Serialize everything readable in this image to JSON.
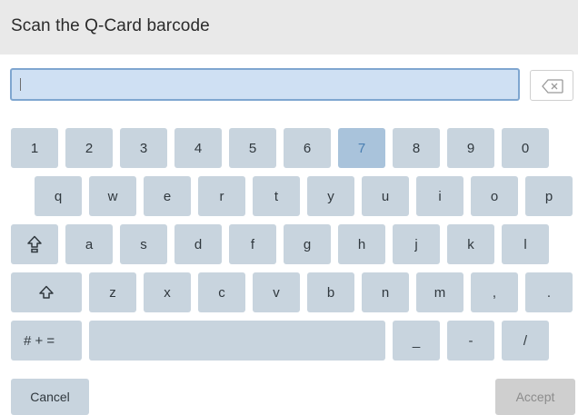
{
  "header": {
    "title": "Scan the Q-Card barcode"
  },
  "input": {
    "value": ""
  },
  "keyboard": {
    "row1": [
      "1",
      "2",
      "3",
      "4",
      "5",
      "6",
      "7",
      "8",
      "9",
      "0"
    ],
    "row2": [
      "q",
      "w",
      "e",
      "r",
      "t",
      "y",
      "u",
      "i",
      "o",
      "p"
    ],
    "row3": [
      "a",
      "s",
      "d",
      "f",
      "g",
      "h",
      "j",
      "k",
      "l"
    ],
    "row4": [
      "z",
      "x",
      "c",
      "v",
      "b",
      "n",
      "m",
      ",",
      "."
    ],
    "row5": {
      "symbols_label": "# + =",
      "underscore": "_",
      "dash": "-",
      "slash": "/"
    },
    "highlighted_key": "7"
  },
  "buttons": {
    "cancel_label": "Cancel",
    "accept_label": "Accept",
    "accept_enabled": false
  },
  "colors": {
    "key_bg": "#c8d4de",
    "key_active_bg": "#a9c3db",
    "input_bg": "#cfe0f3",
    "input_border": "#7fa6d0",
    "header_bg": "#e9e9e9",
    "disabled_bg": "#cfcfcf"
  },
  "icons": {
    "backspace": "backspace-icon",
    "caps_lock": "caps-lock-icon",
    "shift": "shift-icon"
  }
}
